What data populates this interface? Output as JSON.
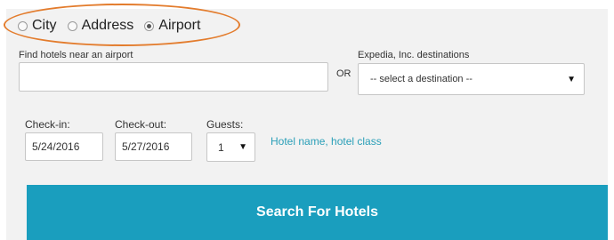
{
  "search_type": {
    "options": [
      {
        "label": "City",
        "checked": false
      },
      {
        "label": "Address",
        "checked": false
      },
      {
        "label": "Airport",
        "checked": true
      }
    ]
  },
  "airport": {
    "label": "Find hotels near an airport",
    "value": ""
  },
  "or_label": "OR",
  "destinations": {
    "label": "Expedia, Inc. destinations",
    "selected": "-- select a destination --"
  },
  "checkin": {
    "label": "Check-in:",
    "value": "5/24/2016"
  },
  "checkout": {
    "label": "Check-out:",
    "value": "5/27/2016"
  },
  "guests": {
    "label": "Guests:",
    "value": "1"
  },
  "hotel_filter_link": "Hotel name, hotel class",
  "search_button": "Search For Hotels",
  "colors": {
    "accent": "#1a9ebe",
    "highlight_oval": "#e37c2d",
    "link": "#2a9fb8"
  }
}
